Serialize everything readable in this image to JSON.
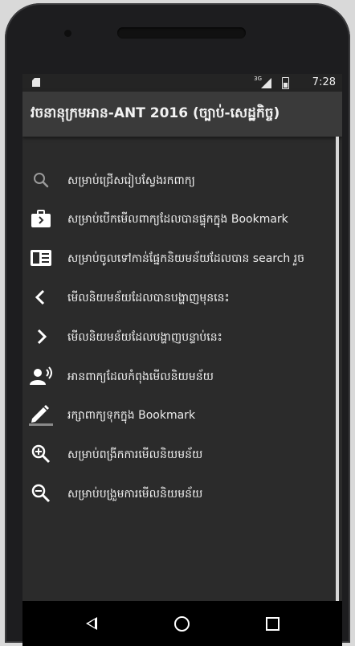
{
  "status_bar": {
    "network": "3G",
    "time": "7:28"
  },
  "app_bar": {
    "title": "វចនានុក្រមអាន-ANT 2016 (ច្បាប់-សេដ្ឋកិច្ច)"
  },
  "menu": {
    "items": [
      {
        "label": "សម្រាប់ជ្រើសរៀបស្វែងរកពាក្យ",
        "icon": "search-icon"
      },
      {
        "label": "សម្រាប់បើកមើលពាក្យដែលបានផ្ទុកក្នុង Bookmark",
        "icon": "bookmark-briefcase-icon"
      },
      {
        "label": "សម្រាប់ចូលទៅកាន់ផ្នែកនិយមន័យដែលបាន search រួច",
        "icon": "reading-icon"
      },
      {
        "label": "មើលនិយមន័យដែលបានបង្ហាញមុននេះ",
        "icon": "chevron-left-icon"
      },
      {
        "label": "មើលនិយមន័យដែលបង្ហាញបន្ទាប់នេះ",
        "icon": "chevron-right-icon"
      },
      {
        "label": "អានពាក្យដែលកំពុងមើលនិយមន័យ",
        "icon": "speaker-person-icon"
      },
      {
        "label": "រក្សាពាក្យទុកក្នុង Bookmark",
        "icon": "pencil-icon"
      },
      {
        "label": "សម្រាប់ពង្រីកការមើលនិយមន័យ",
        "icon": "zoom-in-icon"
      },
      {
        "label": "សម្រាប់បង្រួមការមើលនិយមន័យ",
        "icon": "zoom-out-icon"
      }
    ]
  },
  "nav_bar": {
    "back": "back-icon",
    "home": "home-icon",
    "recents": "recents-icon"
  }
}
